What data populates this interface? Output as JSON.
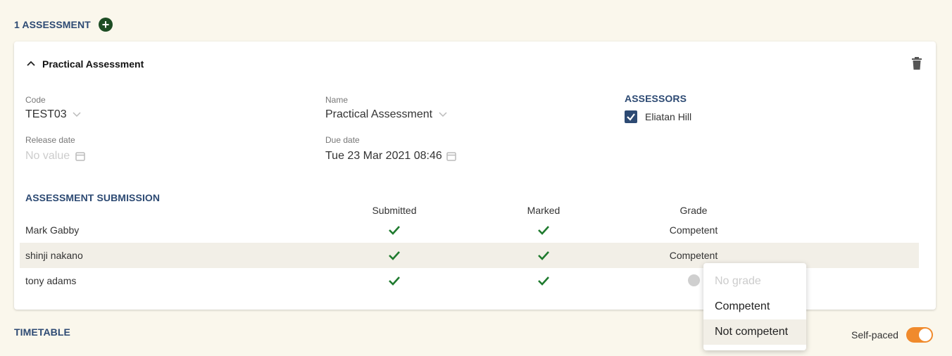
{
  "assessments_header": {
    "title": "1 ASSESSMENT",
    "add_icon": "plus-circle-icon"
  },
  "card": {
    "title": "Practical Assessment",
    "collapse_icon": "chevron-up-icon",
    "delete_icon": "trash-icon",
    "fields": {
      "code": {
        "label": "Code",
        "value": "TEST03"
      },
      "name": {
        "label": "Name",
        "value": "Practical Assessment"
      },
      "release_date": {
        "label": "Release date",
        "placeholder": "No value"
      },
      "due_date": {
        "label": "Due date",
        "value": "Tue 23 Mar 2021 08:46"
      }
    },
    "assessors": {
      "title": "ASSESSORS",
      "items": [
        {
          "name": "Eliatan Hill",
          "checked": true
        }
      ]
    },
    "submission": {
      "title": "ASSESSMENT SUBMISSION",
      "columns": [
        "Submitted",
        "Marked",
        "Grade"
      ],
      "rows": [
        {
          "name": "Mark Gabby",
          "submitted": true,
          "marked": true,
          "grade": "Competent"
        },
        {
          "name": "shinji nakano",
          "submitted": true,
          "marked": true,
          "grade": "Competent"
        },
        {
          "name": "tony adams",
          "submitted": true,
          "marked": true,
          "grade": ""
        }
      ]
    }
  },
  "grade_menu": {
    "options": [
      "No grade",
      "Competent",
      "Not competent"
    ],
    "disabled_option": "No grade",
    "highlighted_option": "Not competent"
  },
  "timetable": {
    "title": "TIMETABLE",
    "self_paced_label": "Self-paced",
    "self_paced_on": true
  },
  "colors": {
    "background": "#faf7ec",
    "accent_blue": "#2d4a73",
    "check_green": "#1f7a2e",
    "toggle_orange": "#f08a2c"
  }
}
